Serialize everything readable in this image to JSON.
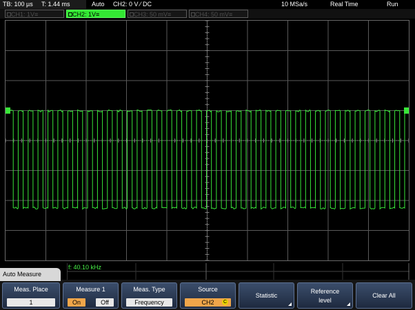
{
  "status": {
    "timebase": "TB: 100 µs",
    "trigger_time": "T: 1.44 ms",
    "mode": "Auto",
    "trigger_info": "CH2: 0 V ⁄ DC",
    "sample_rate": "10 MSa/s",
    "acq_mode": "Real Time",
    "run_state": "Run"
  },
  "channels": [
    {
      "label": "CH1: 1V≡",
      "active": false
    },
    {
      "label": "CH2: 1V≡",
      "active": true
    },
    {
      "label": "CH3: 50 mV≡",
      "active": false
    },
    {
      "label": "CH4: 50 mV≡",
      "active": false
    }
  ],
  "measurement": {
    "freq_text": "f: 40.10 kHz"
  },
  "menu": {
    "title": "Auto Measure",
    "meas_place": {
      "label": "Meas. Place",
      "value": "1"
    },
    "measure1": {
      "label": "Measure 1",
      "on": "On",
      "off": "Off"
    },
    "meas_type": {
      "label": "Meas. Type",
      "value": "Frequency"
    },
    "source": {
      "label": "Source",
      "value": "CH2",
      "icon": "C"
    },
    "statistic": "Statistic",
    "reference_level_1": "Reference",
    "reference_level_2": "level",
    "clear_all": "Clear All"
  },
  "waveform": {
    "color": "#39e639",
    "cycles": 40
  }
}
